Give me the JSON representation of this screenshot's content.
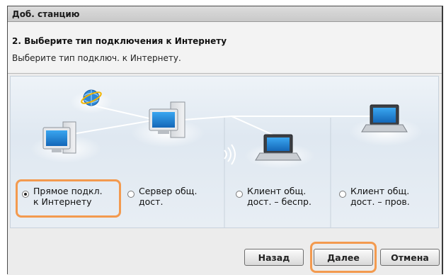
{
  "window": {
    "title": "Доб. станцию"
  },
  "header": {
    "step_title": "2. Выберите тип подключения к Интернету",
    "step_subtitle": "Выберите тип подключ. к Интернету."
  },
  "options": [
    {
      "label": "Прямое подкл.\nк Интернету",
      "selected": true
    },
    {
      "label": "Сервер общ.\nдост.",
      "selected": false
    },
    {
      "label": "Клиент общ.\nдост. – беспр.",
      "selected": false
    },
    {
      "label": "Клиент общ.\nдост. – пров.",
      "selected": false
    }
  ],
  "buttons": {
    "back": "Назад",
    "next": "Далее",
    "cancel": "Отмена"
  },
  "colors": {
    "highlight": "#f39a4f",
    "screen_blue": "#1f8ad8"
  },
  "icons": [
    "internet-globe-icon",
    "desktop-computer-icon",
    "server-computer-icon",
    "laptop-icon",
    "wireless-signal-icon"
  ]
}
